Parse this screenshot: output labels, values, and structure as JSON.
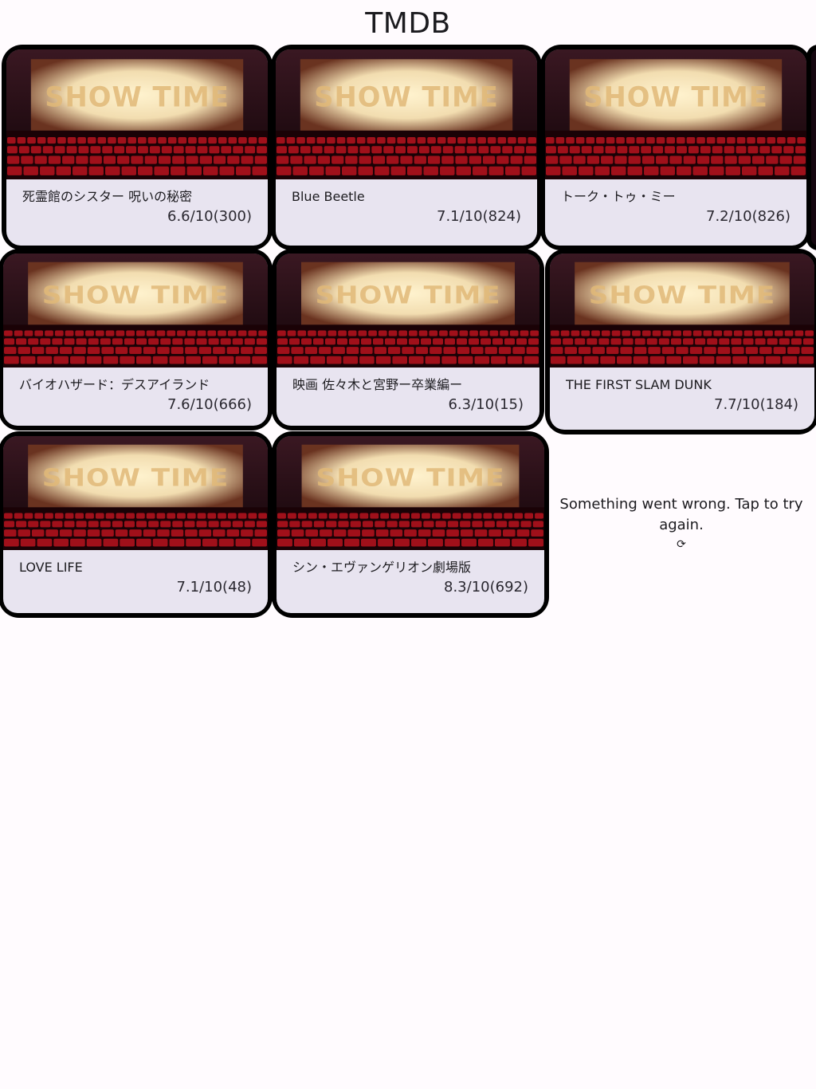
{
  "app": {
    "title": "TMDB"
  },
  "poster": {
    "banner_text": "SHOW TIME"
  },
  "movies": [
    {
      "title": "死霊館のシスター 呪いの秘密",
      "rating": "6.6/10(300)"
    },
    {
      "title": "Blue Beetle",
      "rating": "7.1/10(824)"
    },
    {
      "title": "トーク・トゥ・ミー",
      "rating": "7.2/10(826)"
    },
    {
      "title": "バイオハザード：デスアイランド",
      "rating": "7.6/10(666)"
    },
    {
      "title": "映画 佐々木と宮野ー卒業編ー",
      "rating": "6.3/10(15)"
    },
    {
      "title": "THE FIRST SLAM DUNK",
      "rating": "7.7/10(184)"
    },
    {
      "title": "LOVE LIFE",
      "rating": "7.1/10(48)"
    },
    {
      "title": "シン・エヴァンゲリオン劇場版",
      "rating": "8.3/10(692)"
    }
  ],
  "error": {
    "message": "Something went wrong. Tap to try again.",
    "retry_icon": "refresh-icon"
  },
  "colors": {
    "background": "#fffbfe",
    "card_border": "#000000",
    "card_info": "#e8e4f0",
    "seat_red": "#a0101a",
    "screen_glow": "#fff3cf"
  }
}
